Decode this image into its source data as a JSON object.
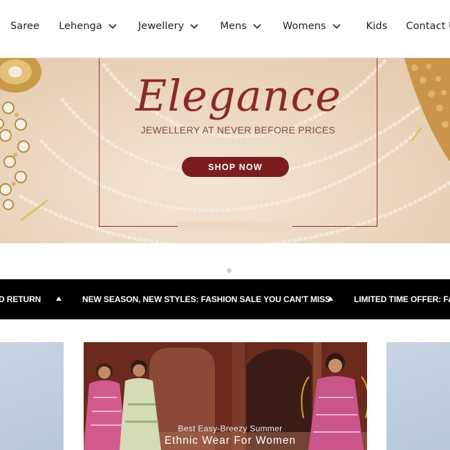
{
  "nav": {
    "items": [
      {
        "label": "Saree",
        "has_dropdown": false
      },
      {
        "label": "Lehenga",
        "has_dropdown": true
      },
      {
        "label": "Jewellery",
        "has_dropdown": true
      },
      {
        "label": "Mens",
        "has_dropdown": true
      },
      {
        "label": "Womens",
        "has_dropdown": true
      },
      {
        "label": "Kids",
        "has_dropdown": false
      },
      {
        "label": "Contact Us",
        "has_dropdown": false
      }
    ]
  },
  "hero": {
    "headline": "Elegance",
    "tagline": "JEWELLERY AT NEVER BEFORE PRICES",
    "cta_label": "SHOP NOW",
    "accent_color": "#8b2a27",
    "button_color": "#7a1d1e"
  },
  "slider": {
    "active_dot": 1,
    "dot_count": 1
  },
  "announcement": {
    "messages": [
      "D RETURN",
      "NEW SEASON, NEW STYLES: FASHION SALE YOU CAN'T MISS",
      "LIMITED TIME OFFER: FASI"
    ],
    "separator_icon": "triangle-up-icon"
  },
  "banner": {
    "subtitle": "Best Easy-Breezy Summer",
    "title": "Ethnic Wear For Women"
  }
}
